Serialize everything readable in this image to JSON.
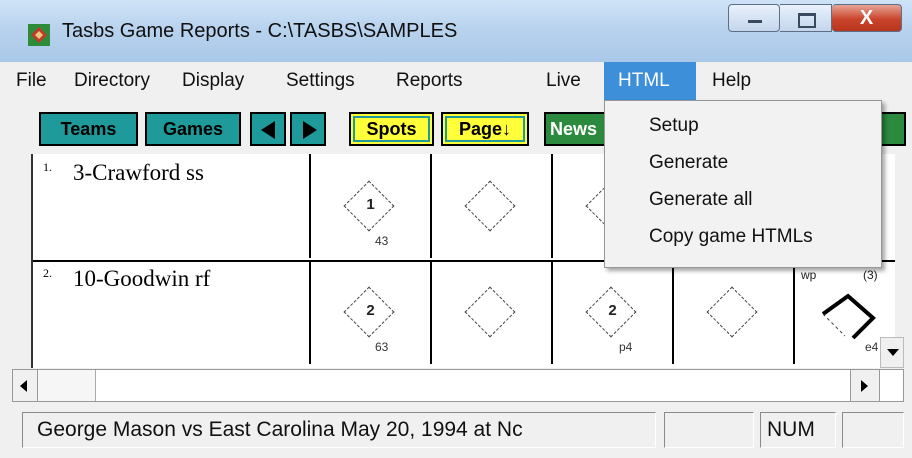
{
  "window": {
    "title": "Tasbs Game Reports - C:\\TASBS\\SAMPLES",
    "close_glyph": "X"
  },
  "menu": {
    "items": [
      "File",
      "Directory",
      "Display",
      "Settings",
      "Reports",
      "Live",
      "HTML",
      "Help"
    ],
    "active": "HTML"
  },
  "toolbar": {
    "teams": "Teams",
    "games": "Games",
    "spots": "Spots",
    "page": "Page↓",
    "news": "News",
    "prev_icon": "left-arrow-icon",
    "next_icon": "right-arrow-icon"
  },
  "html_menu": {
    "items": [
      "Setup",
      "Generate",
      "Generate all",
      "Copy game HTMLs"
    ]
  },
  "scoresheet": {
    "players": [
      {
        "num": "1.",
        "name": "3-Crawford ss",
        "innings": [
          {
            "mark": "1",
            "play": "43"
          },
          {
            "mark": "",
            "play": ""
          },
          {
            "mark": "",
            "play": ""
          }
        ]
      },
      {
        "num": "2.",
        "name": "10-Goodwin rf",
        "innings": [
          {
            "mark": "2",
            "play": "63"
          },
          {
            "mark": "",
            "play": ""
          },
          {
            "mark": "2",
            "play": "p4"
          },
          {
            "mark": "",
            "play": ""
          },
          {
            "mark": "",
            "play": "e4",
            "note_left": "wp",
            "note_right": "(3)"
          }
        ]
      }
    ]
  },
  "status": {
    "game": "George Mason vs East Carolina  May 20, 1994 at Nc",
    "pane2": "",
    "num": "NUM",
    "pane4": ""
  },
  "colors": {
    "teal_button": "#1f9a9a",
    "yellow_button": "#ffff3a",
    "green_button": "#2b8a3e",
    "menu_highlight": "#3c8fd8"
  }
}
